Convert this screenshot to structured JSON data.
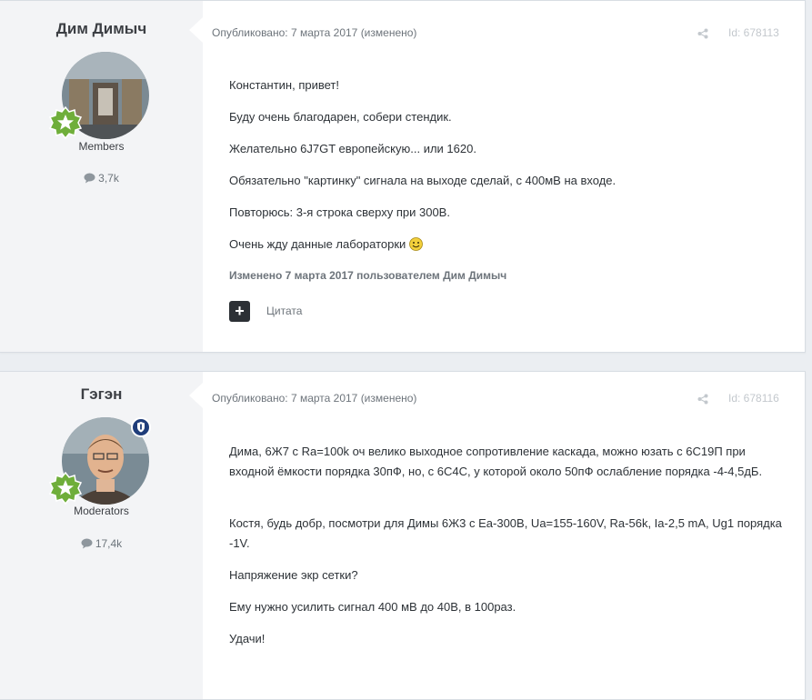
{
  "posts": [
    {
      "author": "Дим Димыч",
      "group": "Members",
      "reputation": "3,7k",
      "meta": "Опубликовано: 7 марта 2017 (изменено)",
      "post_id": "Id: 678113",
      "paragraphs": [
        "Константин, привет!",
        "Буду очень благодарен, собери стендик.",
        "Желательно 6J7GT европейскую... или 1620.",
        "Обязательно \"картинку\" сигнала на выходе сделай, с 400мВ на входе.",
        "Повторюсь: 3-я строка сверху при 300В.",
        "Очень жду данные лабораторки"
      ],
      "edited_note": "Изменено 7 марта 2017 пользователем Дим Димыч",
      "quote_label": "Цитата",
      "quote_button": "+"
    },
    {
      "author": "Гэгэн",
      "group": "Moderators",
      "reputation": "17,4k",
      "meta": "Опубликовано: 7 марта 2017 (изменено)",
      "post_id": "Id: 678116",
      "paragraphs": [
        "Дима, 6Ж7 с Ra=100k оч велико выходное сопротивление каскада, можно юзать с 6С19П при входной ёмкости порядка 30пФ, но, с 6С4С, у которой около 50пФ ослабление порядка -4-4,5дБ.",
        "Костя, будь добр, посмотри для Димы 6Ж3 с Еа-300В, Uа=155-160V, Ra-56k, Ia-2,5 mA, Ug1 порядка -1V.",
        "Напряжение экр сетки?",
        "Ему нужно усилить сигнал 400 мВ до 40В, в 100раз.",
        "Удачи!"
      ]
    }
  ],
  "colors": {
    "page_bg": "#ebeef2",
    "author_bg": "#f3f4f6",
    "rank_badge": "#6fae3a",
    "moderator_badge": "#1f3d7a"
  }
}
